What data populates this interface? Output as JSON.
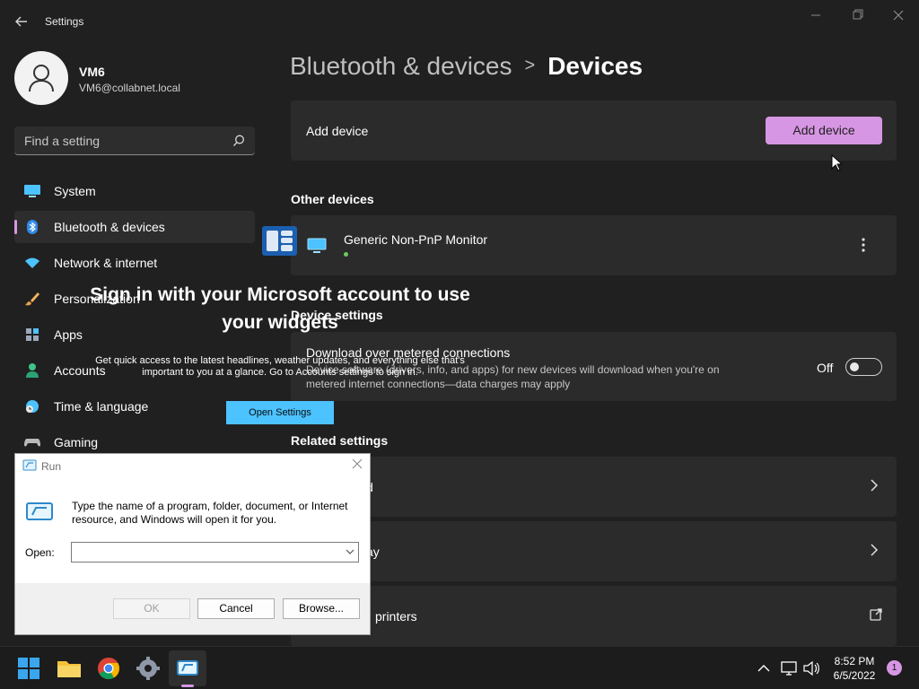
{
  "window": {
    "title": "Settings",
    "controls": [
      "minimize",
      "maximize",
      "close"
    ]
  },
  "user": {
    "name": "VM6",
    "email": "VM6@collabnet.local"
  },
  "search": {
    "placeholder": "Find a setting"
  },
  "nav": {
    "items": [
      {
        "label": "System",
        "icon": "monitor-icon"
      },
      {
        "label": "Bluetooth & devices",
        "icon": "bluetooth-icon",
        "active": true
      },
      {
        "label": "Network & internet",
        "icon": "wifi-icon"
      },
      {
        "label": "Personalization",
        "icon": "brush-icon"
      },
      {
        "label": "Apps",
        "icon": "apps-icon"
      },
      {
        "label": "Accounts",
        "icon": "person-icon"
      },
      {
        "label": "Time & language",
        "icon": "clock-globe-icon"
      },
      {
        "label": "Gaming",
        "icon": "gamepad-icon"
      }
    ]
  },
  "breadcrumb": {
    "parent": "Bluetooth & devices",
    "separator": ">",
    "current": "Devices"
  },
  "add_device": {
    "label": "Add device",
    "button": "Add device",
    "accent": "#d796e3"
  },
  "other_devices": {
    "title": "Other devices",
    "device": {
      "name": "Generic Non-PnP Monitor",
      "status_color": "#6ccb5f"
    }
  },
  "device_settings": {
    "title": "Device settings",
    "metered": {
      "title": "Download over metered connections",
      "description": "Device software (drivers, info, and apps) for new devices will download when you're on metered internet connections—data charges may apply",
      "state_label": "Off",
      "on": false
    }
  },
  "related_settings": {
    "title": "Related settings",
    "items": [
      {
        "text": "d",
        "action": "chevron"
      },
      {
        "text": "ay",
        "action": "chevron"
      },
      {
        "text": "printers",
        "action": "external"
      }
    ]
  },
  "widgets_promo": {
    "title": "Sign in with your Microsoft account to use your widgets",
    "text": "Get quick access to the latest headlines, weather updates, and everything else that's important to you at a glance. Go to Accounts settings to sign in.",
    "button": "Open Settings"
  },
  "run_dialog": {
    "title": "Run",
    "description": "Type the name of a program, folder, document, or Internet resource, and Windows will open it for you.",
    "open_label": "Open:",
    "open_value": "",
    "buttons": {
      "ok": "OK",
      "cancel": "Cancel",
      "browse": "Browse..."
    }
  },
  "taskbar": {
    "apps": [
      "start-icon",
      "file-explorer-icon",
      "chrome-icon",
      "settings-icon",
      "run-icon"
    ],
    "time": "8:52 PM",
    "date": "6/5/2022",
    "notification_count": "1"
  }
}
